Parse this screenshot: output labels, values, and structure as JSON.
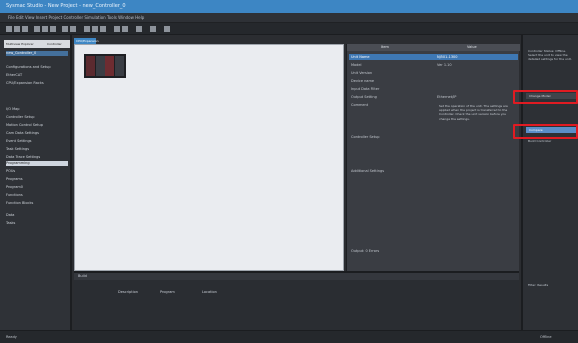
{
  "title_bar": {
    "title": "Sysmac Studio - New Project - new_Controller_0"
  },
  "menu": {
    "text": "File  Edit  View  Insert  Project  Controller  Simulation  Tools  Window  Help"
  },
  "left_pane": {
    "tabs": [
      "Multiview Explorer",
      "Controller"
    ],
    "tree": [
      "new_Controller_0",
      "Configurations and Setup",
      "  EtherCAT",
      "  CPU/Expansion Racks",
      "  I/O Map",
      "  Controller Setup",
      "  Motion Control Setup",
      "  Cam Data Settings",
      "  Event Settings",
      "  Task Settings",
      "  Data Trace Settings",
      "Programming",
      "  POUs",
      "    Programs",
      "      Program0",
      "    Functions",
      "    Function Blocks",
      "  Data",
      "  Tasks"
    ]
  },
  "editor": {
    "tab_label": "CPU/Expansion"
  },
  "properties": {
    "header": [
      "Item",
      "Value"
    ],
    "rows": [
      {
        "k": "Unit Name",
        "v": "NJ501-1300"
      },
      {
        "k": "Model",
        "v": "Ver 1.10"
      },
      {
        "k": "Unit Version",
        "v": ""
      },
      {
        "k": "Device name",
        "v": ""
      },
      {
        "k": "Input Data Filter",
        "v": ""
      },
      {
        "k": "Output Setting",
        "v": "Ethernet/IP"
      },
      {
        "k": "Comment",
        "v": ""
      }
    ],
    "description": "Set the operation of the unit. The settings are applied when the project is transferred to the Controller. Check the unit version before you change the settings.",
    "mid_label": "Controller Setup",
    "extra_label": "Additional Settings",
    "footer": "Output: 0 Errors"
  },
  "right_pane": {
    "text1": "Controller Status: Offline. Select the unit to view the detailed settings for the unit.",
    "btn1": "Change Model",
    "btn2": "Compare",
    "text2": "Build Controller",
    "footer": "Filter: Results"
  },
  "bottom": {
    "header": "Build",
    "columns": [
      "Description",
      "Program",
      "Location"
    ]
  },
  "status": {
    "left": "Ready",
    "right": "Offline"
  },
  "colors": {
    "accent": "#3d86c4",
    "highlight_box": "#e01b22"
  }
}
